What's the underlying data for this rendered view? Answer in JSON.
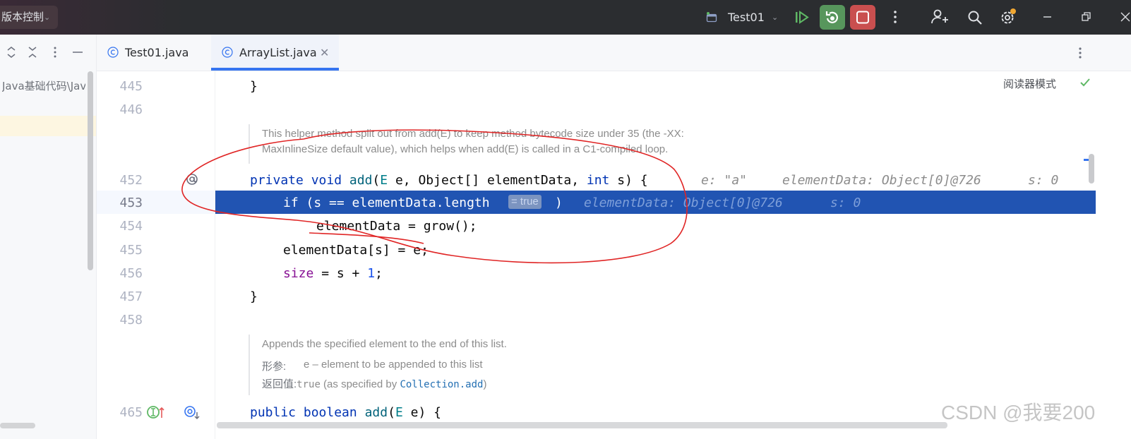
{
  "titlebar": {
    "vcs_label": "版本控制",
    "run_config": "Test01",
    "icons": [
      "chevron-down-icon",
      "run-config-icon",
      "resume-icon",
      "debug-rerun-icon",
      "stop-icon",
      "more-vertical-icon",
      "add-profile-icon",
      "search-icon",
      "settings-icon",
      "minimize-icon",
      "restore-icon",
      "close-icon"
    ],
    "colors": {
      "bar_bg": "#2b2d30",
      "debug_green": "#57965c",
      "stop_red": "#c94f4f",
      "notify_dot": "#f0a732"
    }
  },
  "project_panel": {
    "path_text": "Java基础代码\\Java",
    "icons": [
      "expand-all-icon",
      "collapse-all-icon",
      "more-vertical-icon",
      "hide-panel-icon"
    ]
  },
  "tabs": [
    {
      "label": "Test01.java",
      "active": false,
      "icon": "java-class-icon"
    },
    {
      "label": "ArrayList.java",
      "active": true,
      "icon": "java-class-icon",
      "closable": true
    }
  ],
  "editor": {
    "reader_mode": "阅读器模式",
    "line_numbers": [
      "445",
      "446",
      "452",
      "453",
      "454",
      "455",
      "456",
      "457",
      "458",
      "465"
    ],
    "code": {
      "l445": "}",
      "l452": {
        "kw1": "private",
        "kw2": "void",
        "fn": "add",
        "p1": "(",
        "tp": "E",
        "p2": " e, Object[] elementData, ",
        "kw3": "int",
        "p3": " s) {"
      },
      "l453": {
        "text": "if (s == elementData.length",
        "inlay": "= true",
        "close": ")"
      },
      "l454": "elementData = grow();",
      "l455": {
        "a": "elementData[s] = e;"
      },
      "l456": {
        "fld": "size",
        "mid": " = s + ",
        "num": "1",
        "end": ";"
      },
      "l457": "}",
      "l465": {
        "kw1": "public",
        "kw2": "boolean",
        "fn": "add",
        "p1": "(",
        "tp": "E",
        "p2": " e) {"
      }
    },
    "debug_hints": {
      "l452_e": "e: \"a\"",
      "l452_data": "elementData: Object[0]@726",
      "l452_s": "s: 0",
      "l453_data": "elementData: Object[0]@726",
      "l453_s": "s: 0"
    },
    "doc1": {
      "line1": "This helper method split out from add(E) to keep method bytecode size under 35 (the -XX:",
      "line2": "MaxInlineSize default value), which helps when add(E) is called in a C1-compiled loop."
    },
    "doc2": {
      "line1": "Appends the specified element to the end of this list.",
      "param_label": "形参:",
      "param_text": "e – element to be appended to this list",
      "return_label": "返回值:",
      "return_code": "true",
      "return_mid": " (as specified by ",
      "return_link": "Collection.add",
      "return_end": ")"
    },
    "colors": {
      "exec_line": "#2154b2",
      "keyword": "#0033b3",
      "function": "#00627a",
      "field": "#871094",
      "number": "#1750eb"
    }
  },
  "watermark": "CSDN @我要200"
}
